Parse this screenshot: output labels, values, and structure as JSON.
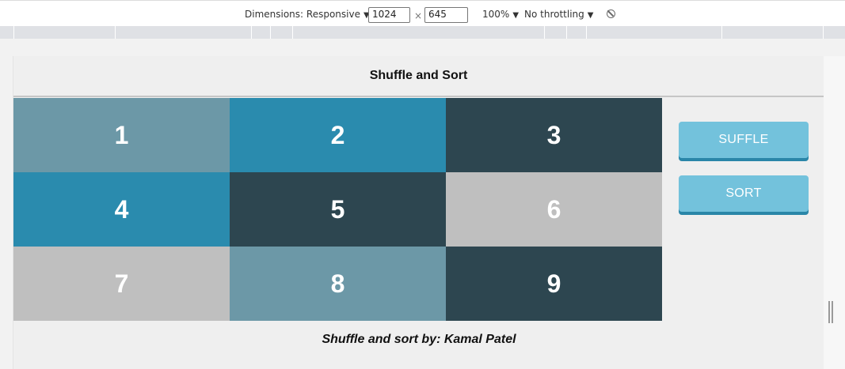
{
  "devtools": {
    "dimensions_label": "Dimensions: Responsive",
    "width_value": "1024",
    "times_sign": "×",
    "height_value": "645",
    "zoom": "100%",
    "throttling": "No throttling",
    "caret": "▼"
  },
  "page": {
    "title": "Shuffle and Sort",
    "tiles": [
      {
        "label": "1",
        "color": "#6c98a7"
      },
      {
        "label": "2",
        "color": "#2a8bae"
      },
      {
        "label": "3",
        "color": "#2d4650"
      },
      {
        "label": "4",
        "color": "#2a8bae"
      },
      {
        "label": "5",
        "color": "#2d4650"
      },
      {
        "label": "6",
        "color": "#bfbfbf"
      },
      {
        "label": "7",
        "color": "#bfbfbf"
      },
      {
        "label": "8",
        "color": "#6c98a7"
      },
      {
        "label": "9",
        "color": "#2d4650"
      }
    ],
    "shuffle_button": "SUFFLE",
    "sort_button": "SORT",
    "footer": "Shuffle and sort by: Kamal Patel"
  }
}
